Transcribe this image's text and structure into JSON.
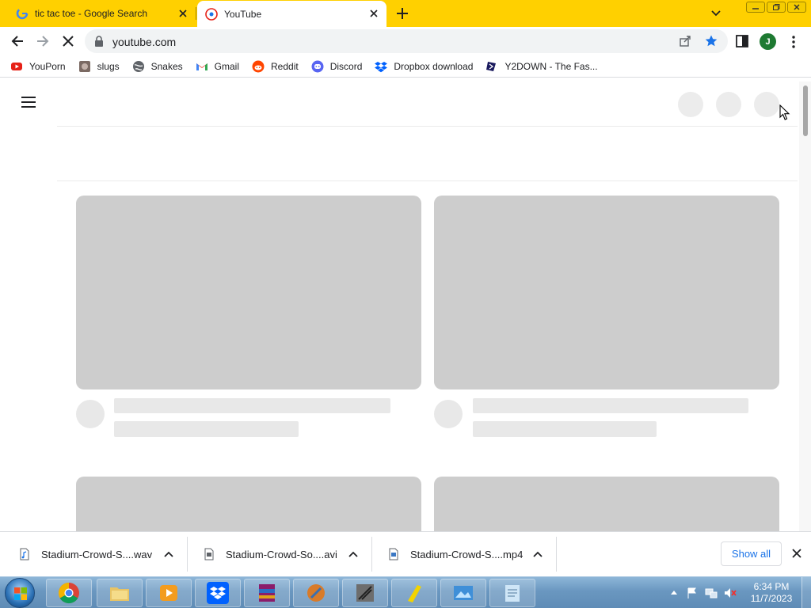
{
  "tabs": [
    {
      "title": "tic tac toe - Google Search",
      "favicon": "google-icon"
    },
    {
      "title": "YouTube",
      "favicon": "youtube-icon"
    }
  ],
  "toolbar": {
    "url": "youtube.com",
    "profile_initial": "J"
  },
  "bookmarks": [
    {
      "label": "YouPorn",
      "icon": "youporn-icon"
    },
    {
      "label": "slugs",
      "icon": "slugs-icon"
    },
    {
      "label": "Snakes",
      "icon": "globe-icon"
    },
    {
      "label": "Gmail",
      "icon": "gmail-icon"
    },
    {
      "label": "Reddit",
      "icon": "reddit-icon"
    },
    {
      "label": "Discord",
      "icon": "discord-icon"
    },
    {
      "label": "Dropbox download",
      "icon": "dropbox-icon"
    },
    {
      "label": "Y2DOWN - The Fas...",
      "icon": "y2down-icon"
    }
  ],
  "downloads": {
    "items": [
      {
        "name": "Stadium-Crowd-S....wav",
        "icon": "audio-file-icon"
      },
      {
        "name": "Stadium-Crowd-So....avi",
        "icon": "video-file-icon"
      },
      {
        "name": "Stadium-Crowd-S....mp4",
        "icon": "video-file-icon"
      }
    ],
    "show_all": "Show all"
  },
  "taskbar": {
    "apps": [
      "chrome-icon",
      "file-explorer-icon",
      "media-player-icon",
      "dropbox-icon",
      "winrar-icon",
      "app-icon",
      "app-icon",
      "notes-icon",
      "photo-viewer-icon",
      "notepad-icon"
    ],
    "time": "6:34 PM",
    "date": "11/7/2023"
  },
  "colors": {
    "tab_strip": "#ffd000",
    "skeleton": "#cdcdcd",
    "accent": "#1a73e8"
  }
}
